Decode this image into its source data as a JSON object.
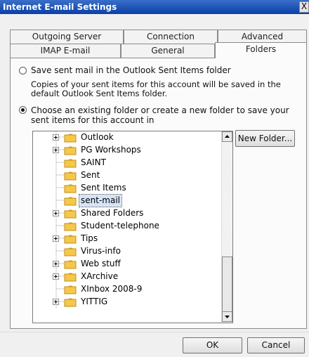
{
  "window": {
    "title": "Internet E-mail Settings",
    "close_glyph": "X"
  },
  "tabs": {
    "row_back": [
      "Outgoing Server",
      "Connection",
      "Advanced"
    ],
    "row_front": [
      "IMAP E-mail",
      "General",
      "Folders"
    ],
    "active": "Folders"
  },
  "options": {
    "save_in_sent_items_label": "Save sent mail in the Outlook Sent Items folder",
    "save_in_sent_items_desc": "Copies of your sent items for this account will be saved in the default Outlook Sent Items folder.",
    "choose_folder_label": "Choose an existing folder or create a new folder to save your sent items for this account in",
    "selected_option": "choose_folder"
  },
  "folder_tree": {
    "items": [
      {
        "label": "Outlook",
        "expandable": true
      },
      {
        "label": "PG Workshops",
        "expandable": true
      },
      {
        "label": "SAINT",
        "expandable": false
      },
      {
        "label": "Sent",
        "expandable": false
      },
      {
        "label": "Sent Items",
        "expandable": false
      },
      {
        "label": "sent-mail",
        "expandable": false,
        "selected": true
      },
      {
        "label": "Shared Folders",
        "expandable": true
      },
      {
        "label": "Student-telephone",
        "expandable": false
      },
      {
        "label": "Tips",
        "expandable": true
      },
      {
        "label": "Virus-info",
        "expandable": false
      },
      {
        "label": "Web stuff",
        "expandable": true
      },
      {
        "label": "XArchive",
        "expandable": true
      },
      {
        "label": "XInbox 2008-9",
        "expandable": false
      },
      {
        "label": "YITTIG",
        "expandable": true
      }
    ],
    "scroll_position_fraction": 0.88
  },
  "buttons": {
    "new_folder": "New Folder...",
    "ok": "OK",
    "cancel": "Cancel"
  },
  "colors": {
    "titlebar": "#0a3fa8",
    "folder": "#f5c84a",
    "selection": "#d6e4f7"
  },
  "icons": {
    "folder": "folder-icon",
    "expand": "plus-expander-icon",
    "scroll_up": "arrow-up-icon",
    "scroll_down": "arrow-down-icon"
  }
}
